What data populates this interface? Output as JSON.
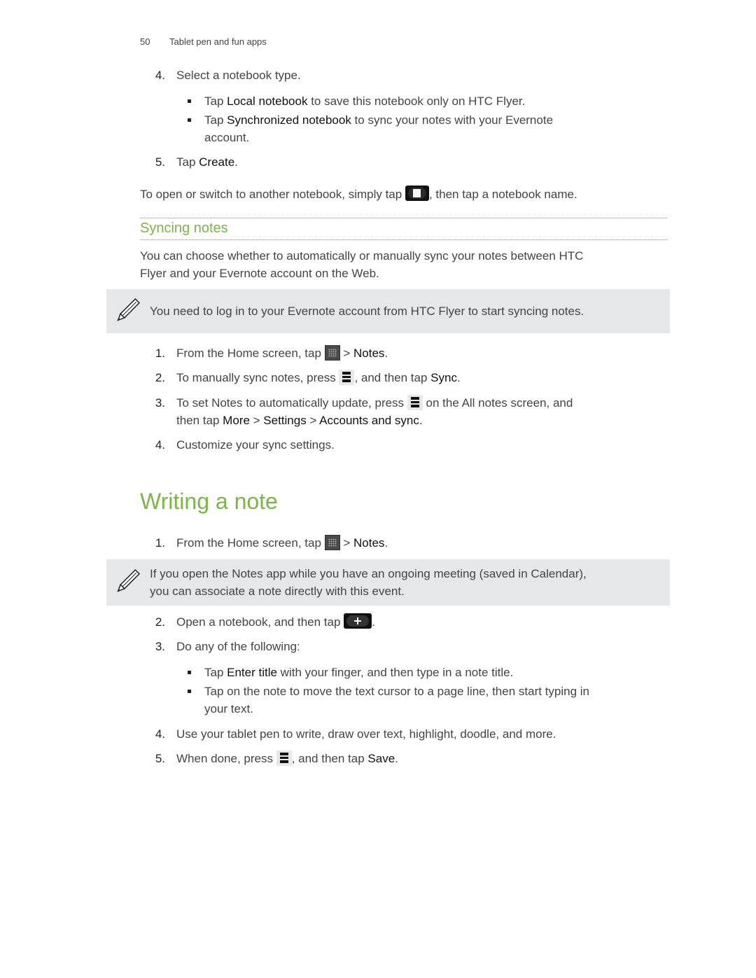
{
  "header": {
    "page_number": "50",
    "section": "Tablet pen and fun apps"
  },
  "steps_top": [
    {
      "num": "4.",
      "text": "Select a notebook type."
    },
    {
      "num": "5.",
      "prefix": "Tap ",
      "bold": "Create",
      "suffix": "."
    }
  ],
  "notebook_bullets": [
    {
      "prefix": "Tap ",
      "bold": "Local notebook",
      "suffix": " to save this notebook only on HTC Flyer."
    },
    {
      "prefix": "Tap ",
      "bold": "Synchronized notebook",
      "suffix": " to sync your notes with your Evernote",
      "line2": "account."
    }
  ],
  "switch_para": {
    "before": "To open or switch to another notebook, simply tap ",
    "icon": "notebook-icon",
    "after": ", then tap a notebook name."
  },
  "syncing": {
    "heading": "Syncing notes",
    "intro_line1": "You can choose whether to automatically or manually sync your notes between HTC",
    "intro_line2": "Flyer and your Evernote account on the Web.",
    "note": "You need to log in to your Evernote account from HTC Flyer to start syncing notes.",
    "steps": [
      {
        "num": "1.",
        "before": "From the Home screen, tap ",
        "icon": "all-apps-icon",
        "after": " > ",
        "bold": "Notes",
        "end": "."
      },
      {
        "num": "2.",
        "before": "To manually sync notes, press ",
        "icon": "menu-icon",
        "after": ", and then tap ",
        "bold": "Sync",
        "end": "."
      },
      {
        "num": "3.",
        "before": "To set Notes to automatically update, press ",
        "icon": "menu-icon",
        "after": " on the All notes screen, and",
        "line2_before": "then tap ",
        "b1": "More",
        "sep1": " > ",
        "b2": "Settings",
        "sep2": " > ",
        "b3": "Accounts and sync",
        "end": "."
      },
      {
        "num": "4.",
        "text": "Customize your sync settings."
      }
    ]
  },
  "writing": {
    "heading": "Writing a note",
    "step1": {
      "num": "1.",
      "before": "From the Home screen, tap ",
      "icon": "all-apps-icon",
      "after": " > ",
      "bold": "Notes",
      "end": "."
    },
    "note_line1": "If you open the Notes app while you have an ongoing meeting (saved in Calendar),",
    "note_line2": "you can associate a note directly with this event.",
    "step2": {
      "num": "2.",
      "before": "Open a notebook, and then tap ",
      "icon": "add-icon",
      "end": "."
    },
    "step3": {
      "num": "3.",
      "text": "Do any of the following:"
    },
    "bullets": [
      {
        "prefix": "Tap ",
        "bold": "Enter title",
        "suffix": " with your finger, and then type in a note title."
      },
      {
        "text": "Tap on the note to move the text cursor to a page line, then start typing in",
        "line2": "your text."
      }
    ],
    "step4": {
      "num": "4.",
      "text": "Use your tablet pen to write, draw over text, highlight, doodle, and more."
    },
    "step5": {
      "num": "5.",
      "before": "When done, press ",
      "icon": "menu-icon",
      "after": ", and then tap ",
      "bold": "Save",
      "end": "."
    }
  }
}
